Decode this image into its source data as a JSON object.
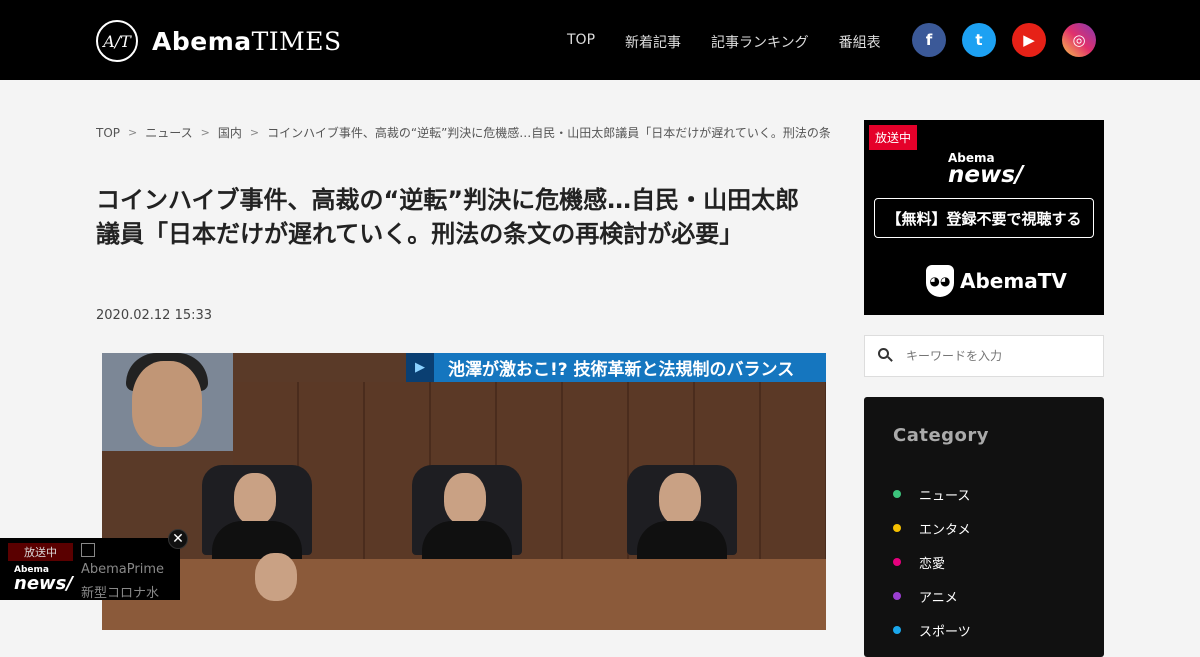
{
  "header": {
    "logo_mark": "A/T",
    "logo_text_a": "Abema",
    "logo_text_b": "TIMES",
    "nav": [
      "TOP",
      "新着記事",
      "記事ランキング",
      "番組表"
    ],
    "social": {
      "facebook": "f",
      "twitter": "t",
      "youtube": "▶",
      "instagram": "◎"
    }
  },
  "breadcrumb": [
    "TOP",
    "ニュース",
    "国内",
    "コインハイブ事件、高裁の“逆転”判決に危機感…自民・山田太郎議員「日本だけが遅れていく。刑法の条文の再検討が必要」"
  ],
  "article": {
    "title": "コインハイブ事件、高裁の“逆転”判決に危機感…自民・山田太郎議員「日本だけが遅れていく。刑法の条文の再検討が必要」",
    "date": "2020.02.12 15:33",
    "image_caption": "池澤が激おこ!? 技術革新と法規制のバランス"
  },
  "sidebar": {
    "live_tag": "放送中",
    "news_small": "Abema",
    "news_large": "news/",
    "register_button": "【無料】登録不要で視聴する",
    "abematv": "AbemaTV",
    "search_placeholder": "キーワードを入力",
    "category_title": "Category",
    "categories": [
      {
        "label": "ニュース",
        "color": "#3cc47c"
      },
      {
        "label": "エンタメ",
        "color": "#f5c000"
      },
      {
        "label": "恋愛",
        "color": "#e6007e"
      },
      {
        "label": "アニメ",
        "color": "#9b3fd1"
      },
      {
        "label": "スポーツ",
        "color": "#1aa7ec"
      }
    ]
  },
  "float_player": {
    "live_tag": "放送中",
    "logo_small": "Abema",
    "logo_large": "news/",
    "close": "✕",
    "channel": "AbemaPrime",
    "subtitle": "新型コロナ水"
  }
}
